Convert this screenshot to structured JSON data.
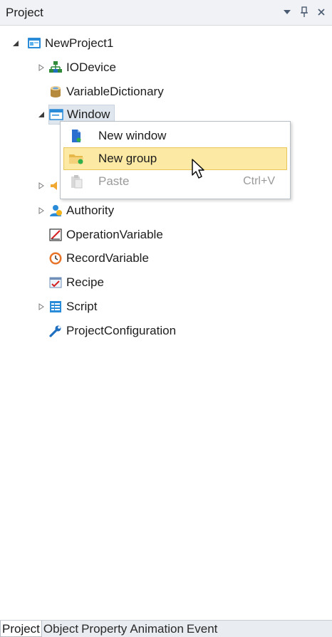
{
  "panel": {
    "title": "Project",
    "controls": [
      "dropdown-icon",
      "pin-icon",
      "close-icon"
    ]
  },
  "tree": {
    "root": {
      "label": "NewProject1",
      "expanded": true
    },
    "items": [
      {
        "label": "IODevice",
        "expander": "collapsed"
      },
      {
        "label": "VariableDictionary",
        "expander": "none"
      },
      {
        "label": "Window",
        "expander": "expanded",
        "selected": true
      },
      {
        "label": "",
        "expander": "collapsed"
      },
      {
        "label": "Authority",
        "expander": "collapsed"
      },
      {
        "label": "OperationVariable",
        "expander": "none"
      },
      {
        "label": "RecordVariable",
        "expander": "none"
      },
      {
        "label": "Recipe",
        "expander": "none"
      },
      {
        "label": "Script",
        "expander": "collapsed"
      },
      {
        "label": "ProjectConfiguration",
        "expander": "none"
      }
    ]
  },
  "context_menu": {
    "items": [
      {
        "label": "New window",
        "shortcut": "",
        "state": "normal"
      },
      {
        "label": "New group",
        "shortcut": "",
        "state": "highlighted"
      },
      {
        "label": "Paste",
        "shortcut": "Ctrl+V",
        "state": "disabled"
      }
    ]
  },
  "bottom_tabs": {
    "tabs": [
      "Project",
      "Object",
      "Property",
      "Animation",
      "Event"
    ],
    "active": "Project"
  },
  "colors": {
    "highlight_bg": "#fce9a3",
    "highlight_border": "#e8c65a",
    "selected_bg": "#dfe6ee"
  }
}
